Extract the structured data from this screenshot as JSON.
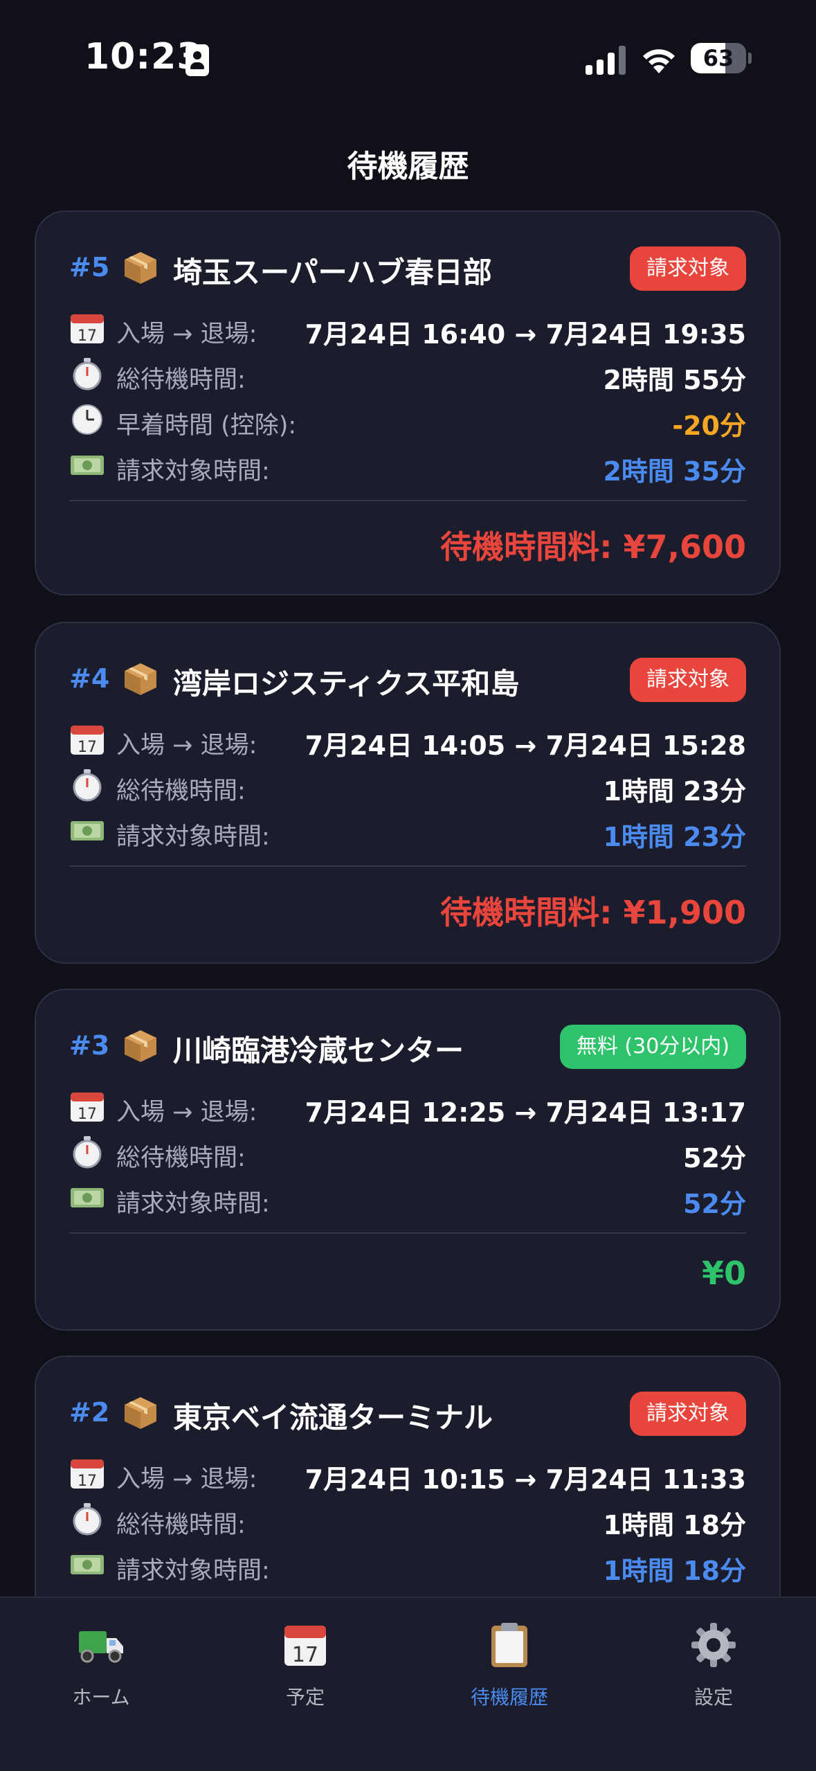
{
  "status_bar": {
    "time": "10:23",
    "battery": 63
  },
  "header": {
    "title": "待機履歴"
  },
  "records": [
    {
      "number": "#5",
      "name": "埼玉スーパーハブ春日部",
      "badge": "請求対象",
      "badge_type": "billable",
      "rows": [
        {
          "icon": "calendar-icon",
          "label": "入場 → 退場:",
          "value": "7月24日 16:40 → 7月24日 19:35",
          "color": "white"
        },
        {
          "icon": "stopwatch-icon",
          "label": "総待機時間:",
          "value": "2時間 55分",
          "color": "white"
        },
        {
          "icon": "clock-icon",
          "label": "早着時間 (控除):",
          "value": "-20分",
          "color": "orange"
        },
        {
          "icon": "money-icon",
          "label": "請求対象時間:",
          "value": "2時間 35分",
          "color": "blue"
        }
      ],
      "fee": "待機時間料: ¥7,600",
      "fee_color": "red"
    },
    {
      "number": "#4",
      "name": "湾岸ロジスティクス平和島",
      "badge": "請求対象",
      "badge_type": "billable",
      "rows": [
        {
          "icon": "calendar-icon",
          "label": "入場 → 退場:",
          "value": "7月24日 14:05 → 7月24日 15:28",
          "color": "white"
        },
        {
          "icon": "stopwatch-icon",
          "label": "総待機時間:",
          "value": "1時間 23分",
          "color": "white"
        },
        {
          "icon": "money-icon",
          "label": "請求対象時間:",
          "value": "1時間 23分",
          "color": "blue"
        }
      ],
      "fee": "待機時間料: ¥1,900",
      "fee_color": "red"
    },
    {
      "number": "#3",
      "name": "川崎臨港冷蔵センター",
      "badge": "無料 (30分以内)",
      "badge_type": "free",
      "rows": [
        {
          "icon": "calendar-icon",
          "label": "入場 → 退場:",
          "value": "7月24日 12:25 → 7月24日 13:17",
          "color": "white"
        },
        {
          "icon": "stopwatch-icon",
          "label": "総待機時間:",
          "value": "52分",
          "color": "white"
        },
        {
          "icon": "money-icon",
          "label": "請求対象時間:",
          "value": "52分",
          "color": "blue"
        }
      ],
      "fee": "¥0",
      "fee_color": "green"
    },
    {
      "number": "#2",
      "name": "東京ベイ流通ターミナル",
      "badge": "請求対象",
      "badge_type": "billable",
      "rows": [
        {
          "icon": "calendar-icon",
          "label": "入場 → 退場:",
          "value": "7月24日 10:15 → 7月24日 11:33",
          "color": "white"
        },
        {
          "icon": "stopwatch-icon",
          "label": "総待機時間:",
          "value": "1時間 18分",
          "color": "white"
        },
        {
          "icon": "money-icon",
          "label": "請求対象時間:",
          "value": "1時間 18分",
          "color": "blue"
        }
      ],
      "fee": "",
      "fee_color": "red"
    }
  ],
  "tabs": [
    {
      "label": "ホーム",
      "icon": "truck-icon",
      "active": false
    },
    {
      "label": "予定",
      "icon": "calendar-icon",
      "active": false
    },
    {
      "label": "待機履歴",
      "icon": "clipboard-icon",
      "active": true
    },
    {
      "label": "設定",
      "icon": "gear-icon",
      "active": false
    }
  ],
  "colors": {
    "background": "#0f1018",
    "card": "#1b1c2c",
    "accent_blue": "#4b8bf0",
    "billable_red": "#e8463c",
    "free_green": "#2ec26a",
    "warning_orange": "#f5a623"
  }
}
